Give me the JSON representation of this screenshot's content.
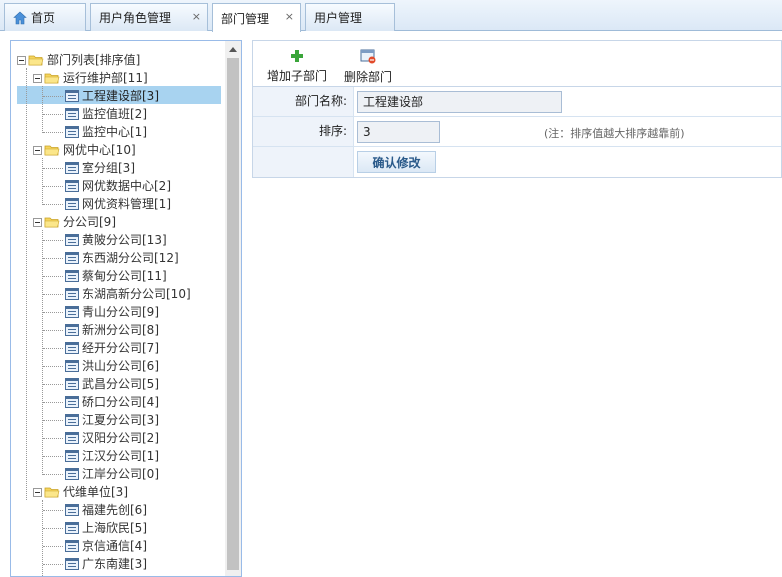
{
  "tabs": [
    {
      "label": "首页",
      "closable": false
    },
    {
      "label": "用户角色管理",
      "closable": true
    },
    {
      "label": "部门管理",
      "closable": true,
      "active": true
    },
    {
      "label": "用户管理",
      "closable": false
    }
  ],
  "close_glyph": "×",
  "tree": {
    "root": "部门列表[排序值]",
    "groups": [
      {
        "label": "运行维护部[11]",
        "children": [
          "工程建设部[3]",
          "监控值班[2]",
          "监控中心[1]"
        ]
      },
      {
        "label": "网优中心[10]",
        "children": [
          "室分组[3]",
          "网优数据中心[2]",
          "网优资料管理[1]"
        ]
      },
      {
        "label": "分公司[9]",
        "children": [
          "黄陂分公司[13]",
          "东西湖分公司[12]",
          "蔡甸分公司[11]",
          "东湖高新分公司[10]",
          "青山分公司[9]",
          "新洲分公司[8]",
          "经开分公司[7]",
          "洪山分公司[6]",
          "武昌分公司[5]",
          "硚口分公司[4]",
          "江夏分公司[3]",
          "汉阳分公司[2]",
          "江汉分公司[1]",
          "江岸分公司[0]"
        ]
      },
      {
        "label": "代维单位[3]",
        "children": [
          "福建先创[6]",
          "上海欣民[5]",
          "京信通信[4]",
          "广东南建[3]"
        ]
      }
    ],
    "selected": "工程建设部[3]"
  },
  "toolbar": {
    "add_label": "增加子部门",
    "delete_label": "删除部门"
  },
  "form": {
    "name_label": "部门名称:",
    "name_value": "工程建设部",
    "sort_label": "排序:",
    "sort_value": "3",
    "sort_note": "(注：排序值越大排序越靠前)",
    "confirm_label": "确认修改"
  },
  "colors": {
    "selected_bg": "#a8d3f0",
    "folder": "#f5d45e",
    "add_icon": "#3aa53a",
    "delete_badge": "#e24b2b"
  }
}
